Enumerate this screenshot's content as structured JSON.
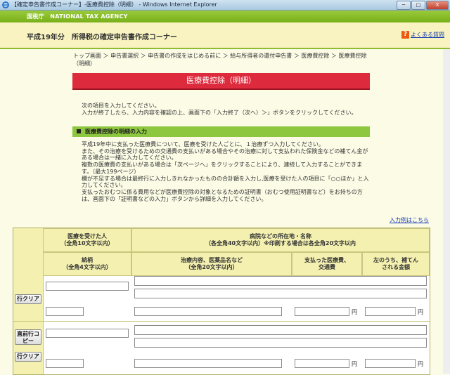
{
  "window": {
    "title": "【確定申告書作成コーナー】-医療費控除（明細） - Windows Internet Explorer",
    "buttons": {
      "minimize": "─",
      "maximize": "□",
      "close": "X"
    }
  },
  "agency": {
    "label": "国税庁　NATIONAL TAX AGENCY"
  },
  "header": {
    "title": "平成19年分　所得税の確定申告書作成コーナー",
    "help_link": "よくある質問",
    "help_icon": "question-icon"
  },
  "breadcrumb": {
    "items": [
      "トップ画面",
      "申告書選択",
      "申告書の作成をはじめる前に",
      "給与所得者の還付申告書",
      "医療費控除",
      "医療費控除（明細）"
    ],
    "separator": "＞"
  },
  "page": {
    "heading": "医療費控除（明細）"
  },
  "intro": {
    "line1": "次の項目を入力してください。",
    "line2": "入力が終了したら、入力内容を確認の上、画面下の「入力終了（次へ）＞」ボタンをクリックしてください。"
  },
  "section": {
    "title": "医療費控除の明細の入力"
  },
  "notes": [
    "平成19年中に支払った医療費について、医療を受けた人ごとに、１治療ずつ入力してください。",
    "また、その治療を受けるための交通費の支払いがある場合やその治療に対して支払われた保険金などの補てん金がある場合は一緒に入力してください。",
    "複数の医療費の支払いがある場合は「次ページへ」をクリックすることにより、連続して入力することができます。（最大199ページ）",
    "欄が不足する場合は最終行に入力しきれなかったものの合計額を入力し,医療を受けた人の項目に「○○ほか」と入力してください。",
    "支払ったおむつに係る費用などが医療費控除の対象となるための証明書（おむつ使用証明書など）をお持ちの方は、画面下の「証明書などの入力」ボタンから詳細を入力してください。"
  ],
  "example_link": "入力例はこちら",
  "table": {
    "col_patient": "医療を受けた人",
    "col_patient_sub": "（全角10文字以内）",
    "col_hospital": "病院などの所在地・名称",
    "col_hospital_sub": "（各全角40文字以内）※印刷する場合は各全角20文字以内",
    "col_relation": "続柄",
    "col_relation_sub": "（全角4文字以内）",
    "col_treatment": "治療内容、医薬品名など",
    "col_treatment_sub": "（全角20文字以内）",
    "col_paid": "支払った医療費、",
    "col_paid_sub": "交通費",
    "col_reimb": "左のうち、補てん",
    "col_reimb_sub": "される金額",
    "btn_row_clear": "行クリア",
    "btn_copy_prev": "直前行コピー",
    "unit_yen": "円"
  },
  "colors": {
    "agency_green": "#78b018",
    "heading_red": "#dd2a3d",
    "section_green": "#8dc63f",
    "header_cream": "#f8f3c0"
  }
}
